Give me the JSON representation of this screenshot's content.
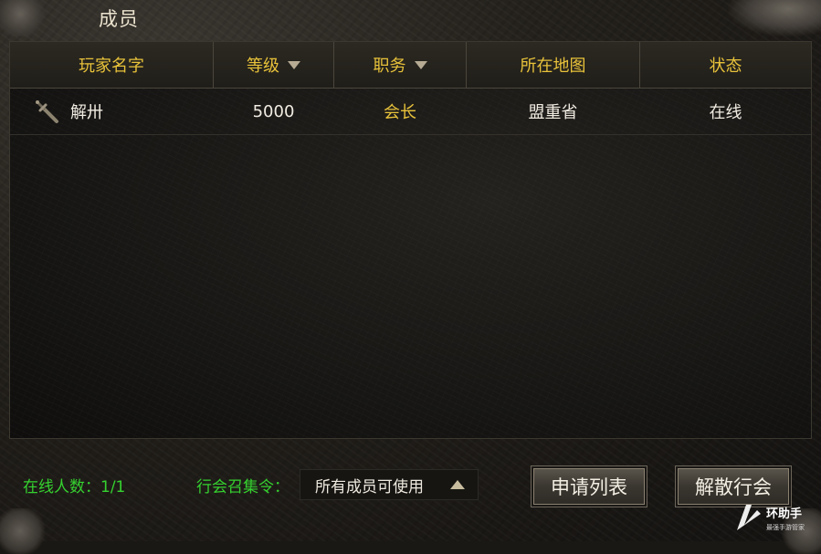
{
  "window": {
    "title": "成员"
  },
  "table": {
    "columns": [
      {
        "label": "玩家名字",
        "sortable": false
      },
      {
        "label": "等级",
        "sortable": true
      },
      {
        "label": "职务",
        "sortable": true
      },
      {
        "label": "所在地图",
        "sortable": false
      },
      {
        "label": "状态",
        "sortable": false
      }
    ],
    "rows": [
      {
        "icon": "sword-icon",
        "name": "解卅",
        "level": "5000",
        "role": "会长",
        "map": "盟重省",
        "status": "在线"
      }
    ]
  },
  "footer": {
    "online_count_label": "在线人数：1/1",
    "summon_label": "行会召集令：",
    "summon_value": "所有成员可使用",
    "apply_list_button": "申请列表",
    "disband_button": "解散行会"
  },
  "watermark": {
    "text": "环助手",
    "subtext": "最强手游管家"
  },
  "colors": {
    "header_text": "#e8c23a",
    "role_text": "#e8c23a",
    "online_label": "#35d12f",
    "body_text": "#f1ece2"
  }
}
